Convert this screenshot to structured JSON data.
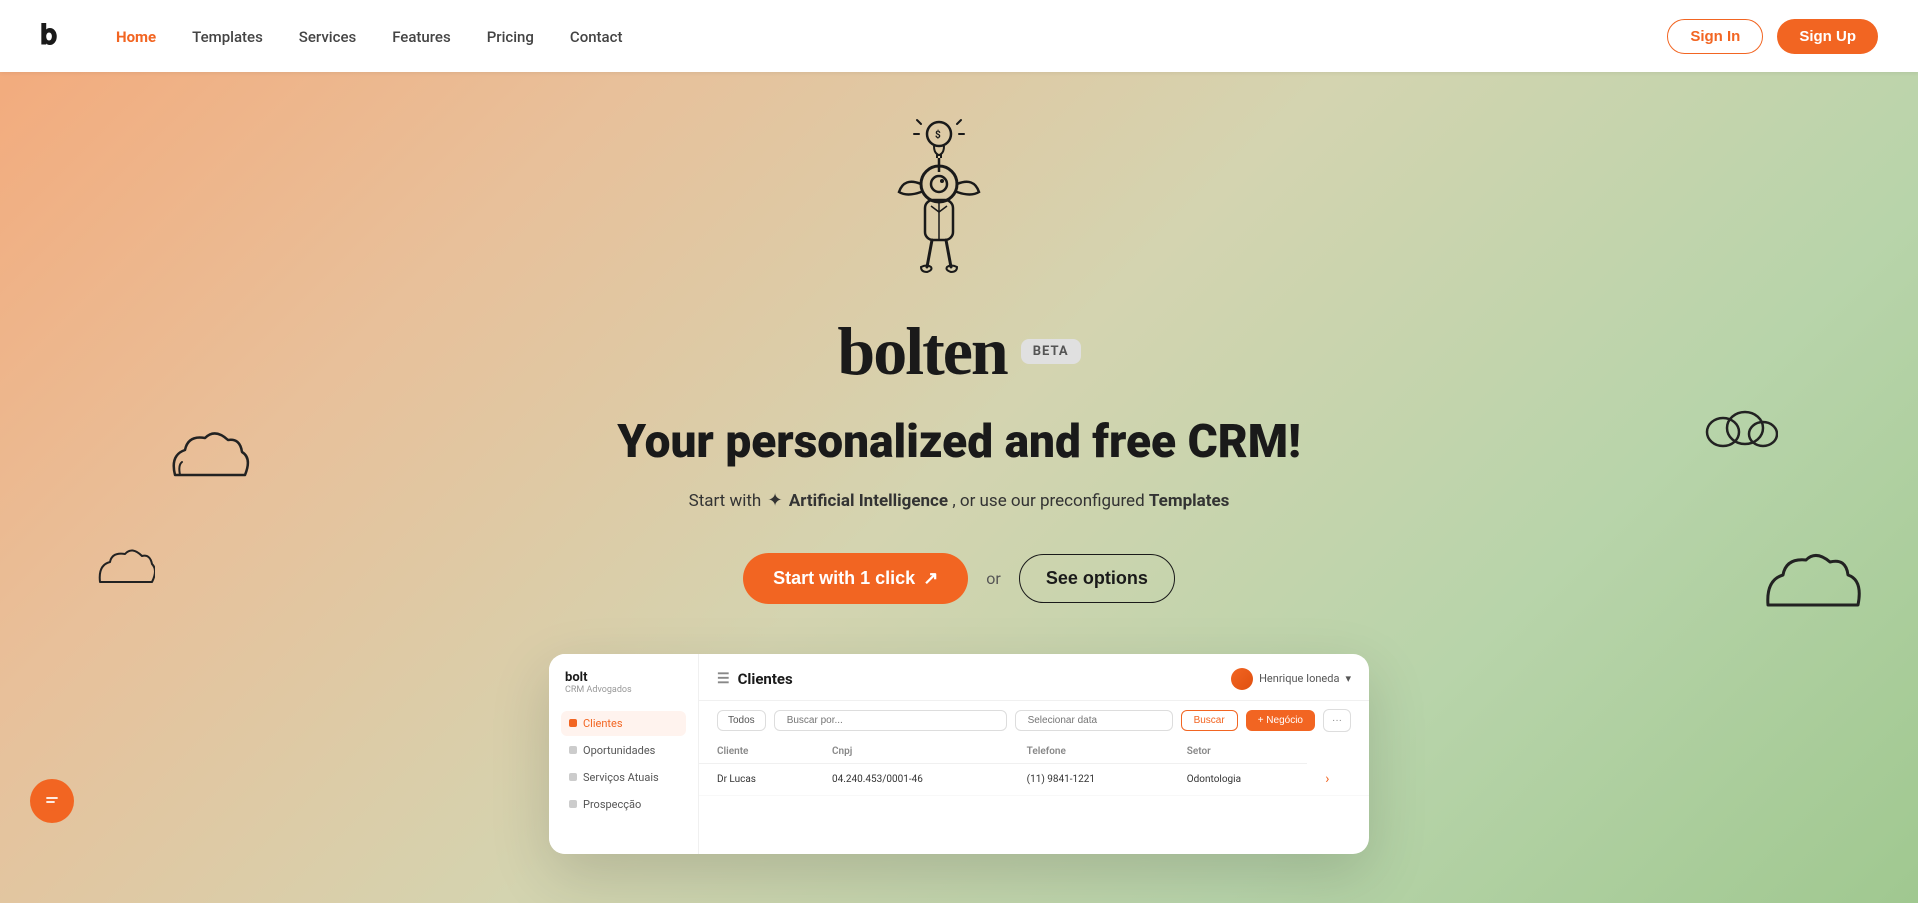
{
  "navbar": {
    "logo_text": "b",
    "links": [
      {
        "label": "Home",
        "active": true
      },
      {
        "label": "Templates",
        "active": false
      },
      {
        "label": "Services",
        "active": false
      },
      {
        "label": "Features",
        "active": false
      },
      {
        "label": "Pricing",
        "active": false
      },
      {
        "label": "Contact",
        "active": false
      }
    ],
    "signin_label": "Sign In",
    "signup_label": "Sign Up"
  },
  "hero": {
    "brand_name": "bolten",
    "beta_label": "BETA",
    "headline": "Your personalized and free CRM!",
    "subtext_prefix": "Start with",
    "ai_label": "Artificial Intelligence",
    "subtext_middle": ", or use our preconfigured",
    "templates_label": "Templates",
    "cta_start": "Start with 1 click",
    "cta_or": "or",
    "cta_options": "See options"
  },
  "dashboard": {
    "logo": "bolt",
    "logo_sub": "CRM Advogados",
    "title": "Clientes",
    "user": "Henrique Ioneda",
    "nav_items": [
      {
        "label": "Clientes",
        "active": true
      },
      {
        "label": "Oportunidades",
        "active": false
      },
      {
        "label": "Serviços Atuais",
        "active": false
      },
      {
        "label": "Prospecção",
        "active": false
      }
    ],
    "filters": {
      "all": "Todos",
      "search_placeholder": "Buscar por...",
      "date_placeholder": "Selecionar data",
      "search_btn": "Buscar",
      "add_btn": "+ Negócio",
      "more_btn": "···"
    },
    "table": {
      "columns": [
        "Cliente",
        "Cnpj",
        "Telefone",
        "Setor"
      ],
      "rows": [
        {
          "cliente": "Dr Lucas",
          "cnpj": "04.240.453/0001-46",
          "telefone": "(11) 9841-1221",
          "setor": "Odontologia"
        }
      ]
    }
  }
}
